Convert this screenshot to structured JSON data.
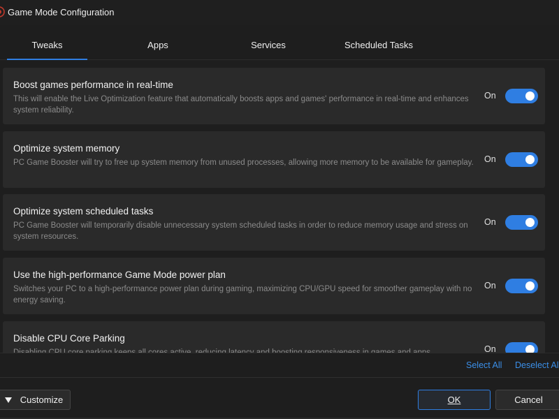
{
  "window": {
    "title": "Game Mode Configuration",
    "icon": "app-logo-icon"
  },
  "tabs": [
    {
      "label": "Tweaks",
      "active": true
    },
    {
      "label": "Apps",
      "active": false
    },
    {
      "label": "Services",
      "active": false
    },
    {
      "label": "Scheduled Tasks",
      "active": false
    }
  ],
  "tweaks": [
    {
      "title": "Boost games performance in real-time",
      "description": "This will enable the Live Optimization feature that automatically boosts apps and games' performance in real-time and enhances system reliability.",
      "state_label": "On",
      "enabled": true
    },
    {
      "title": "Optimize system memory",
      "description": "PC Game Booster will try to free up system memory from unused processes, allowing more memory to be available for gameplay.",
      "state_label": "On",
      "enabled": true
    },
    {
      "title": "Optimize system scheduled tasks",
      "description": "PC Game Booster will temporarily disable unnecessary system scheduled tasks in order to reduce memory usage and stress on system resources.",
      "state_label": "On",
      "enabled": true
    },
    {
      "title": "Use the high-performance Game Mode power plan",
      "description": "Switches your PC to a high-performance power plan during gaming, maximizing CPU/GPU speed for smoother gameplay with no energy saving.",
      "state_label": "On",
      "enabled": true
    },
    {
      "title": "Disable CPU Core Parking",
      "description": "Disabling CPU core parking keeps all cores active, reducing latency and boosting responsiveness in games and apps.",
      "state_label": "On",
      "enabled": true
    }
  ],
  "links": {
    "select_all": "Select All",
    "deselect_all": "Deselect All"
  },
  "buttons": {
    "customize": "Customize",
    "ok": "OK",
    "cancel": "Cancel"
  },
  "colors": {
    "accent": "#2f7ee2",
    "background": "#1e1e1e",
    "card": "#2a2a2a",
    "link": "#3b8fe8",
    "muted_text": "#8b8b8b"
  }
}
